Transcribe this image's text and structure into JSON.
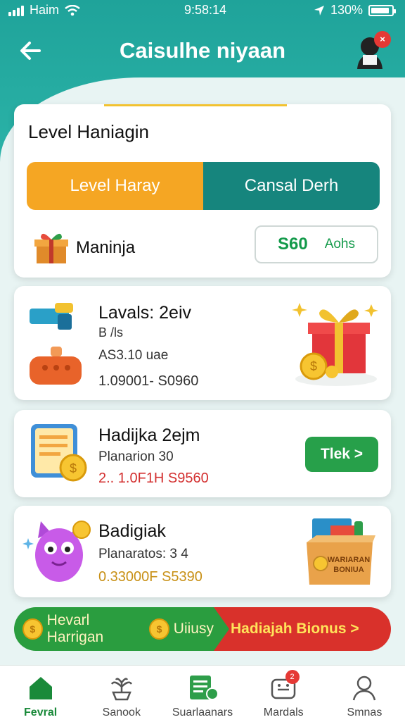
{
  "status": {
    "carrier": "Haim",
    "time": "9:58:14",
    "battery": "130%",
    "battery_level": 0.9
  },
  "header": {
    "title": "Caisulhe niyaan"
  },
  "level_card": {
    "title": "Level Haniagin",
    "tabs": [
      {
        "label": "Level Haray"
      },
      {
        "label": "Cansal Derh"
      }
    ],
    "reward_label": "Maninja",
    "pill_value": "S60",
    "pill_unit": "Aohs"
  },
  "items": [
    {
      "title": "Lavals: 2eiv",
      "line1": "B /ls",
      "line2": "AS3.10 uae",
      "line3": "1.09001- S0960"
    },
    {
      "title": "Hadijka 2ejm",
      "line1": "Planarion 30",
      "line2": "2.. 1.0F1H  S9560",
      "button": "Tlek >"
    },
    {
      "title": "Badigiak",
      "line1": "Planaratos: 3 4",
      "line2": "0.33000F  S5390"
    }
  ],
  "banner": {
    "left_text": "Hevarl Harrigan",
    "middle_text": "Uiiusy",
    "right_text": "Hadiajah Bionus >"
  },
  "tabbar": [
    {
      "label": "Fevral",
      "icon": "home-icon",
      "active": true
    },
    {
      "label": "Sanook",
      "icon": "plant-icon"
    },
    {
      "label": "Suarlaanars",
      "icon": "chat-list-icon"
    },
    {
      "label": "Mardals",
      "icon": "inbox-icon",
      "badge": "2"
    },
    {
      "label": "Smnas",
      "icon": "profile-icon"
    }
  ],
  "colors": {
    "teal": "#1fa39a",
    "orange": "#f5a623",
    "dark_teal": "#16857d",
    "green": "#27a04a",
    "red": "#d9312b"
  }
}
